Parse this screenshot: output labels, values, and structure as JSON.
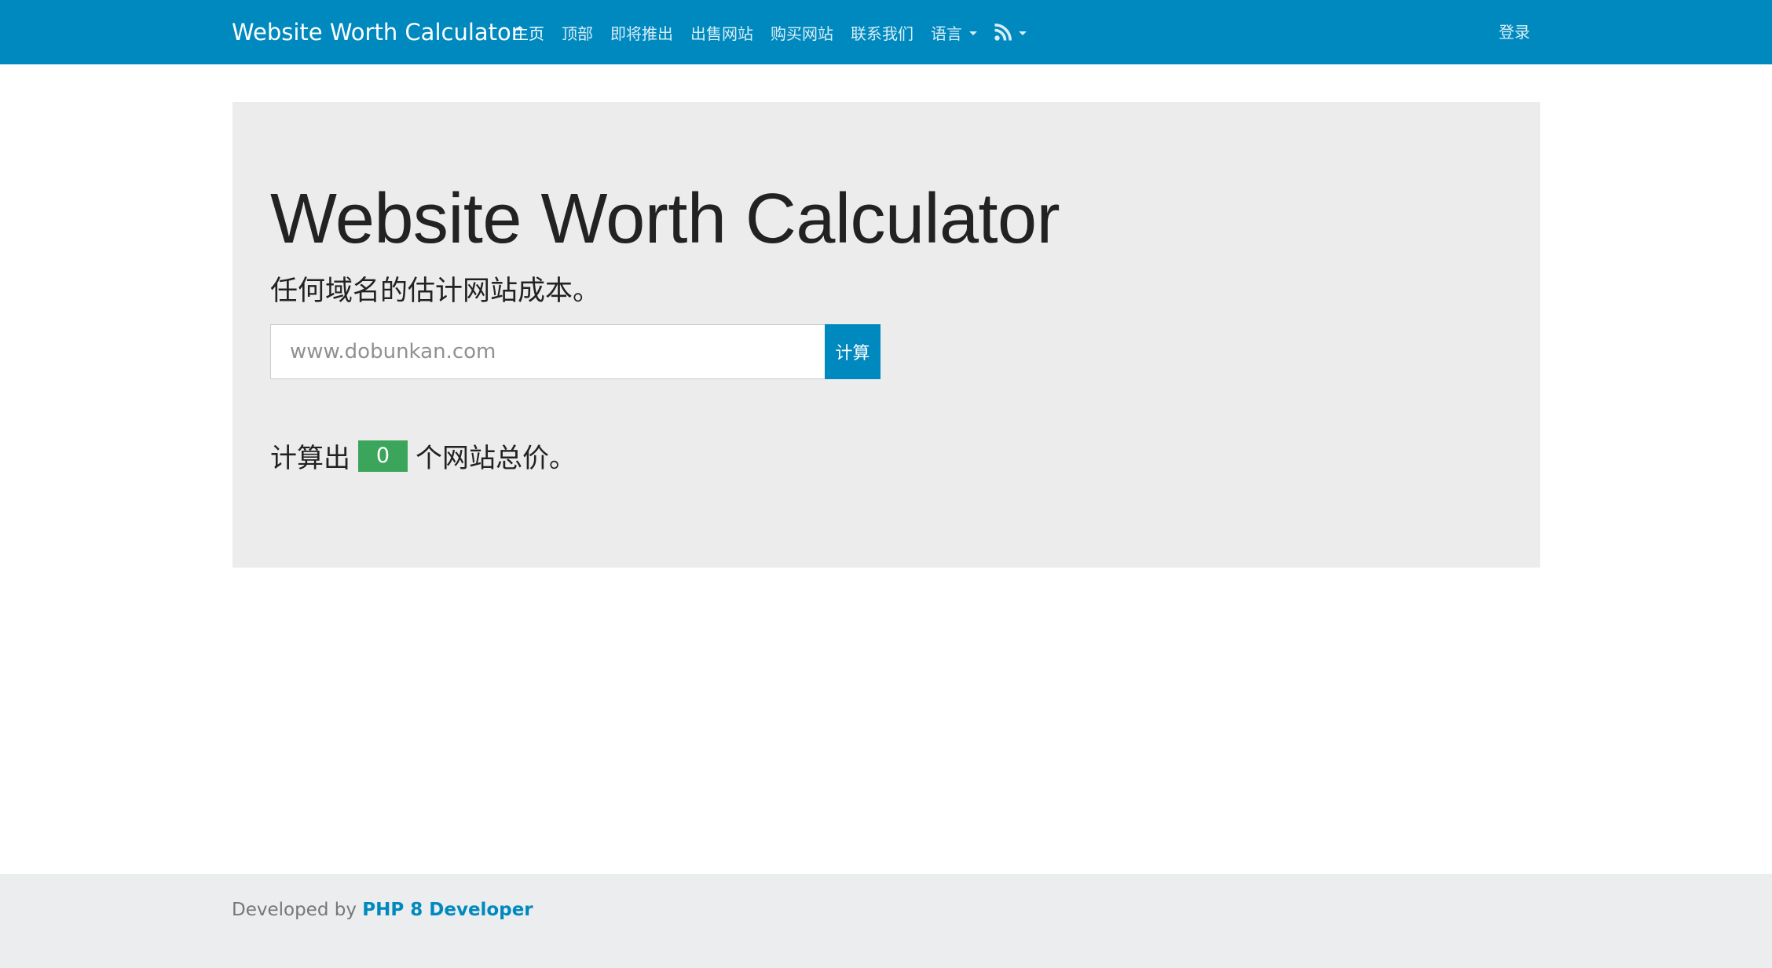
{
  "navbar": {
    "brand": "Website Worth Calculator",
    "items": [
      {
        "label": "主页",
        "active": true
      },
      {
        "label": "顶部"
      },
      {
        "label": "即将推出"
      },
      {
        "label": "出售网站"
      },
      {
        "label": "购买网站"
      },
      {
        "label": "联系我们"
      },
      {
        "label": "语言",
        "dropdown": true
      }
    ],
    "rss": {
      "icon": "rss-icon",
      "dropdown": true
    },
    "login_label": "登录"
  },
  "hero": {
    "title": "Website Worth Calculator",
    "subtitle": "任何域名的估计网站成本。",
    "search": {
      "placeholder": "www.dobunkan.com",
      "value": ""
    },
    "button_label": "计算",
    "stats": {
      "prefix": "计算出",
      "count": "0",
      "suffix": "个网站总价。"
    }
  },
  "footer": {
    "prefix": "Developed by",
    "link_label": "PHP 8 Developer"
  },
  "colors": {
    "primary": "#0089bf",
    "badge": "#3ba55c",
    "jumbotron_bg": "#ececec",
    "footer_bg": "#ebedee"
  }
}
